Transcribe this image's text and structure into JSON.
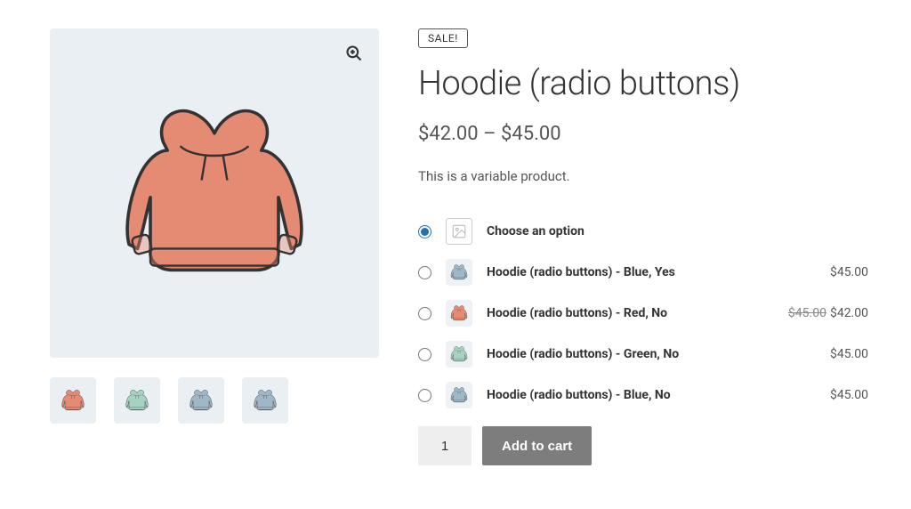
{
  "sale_badge": "SALE!",
  "title": "Hoodie (radio buttons)",
  "price_range": "$42.00 – $45.00",
  "short_description": "This is a variable product.",
  "variations": {
    "default_option_label": "Choose an option",
    "options": [
      {
        "label": "Hoodie (radio buttons) - Blue, Yes",
        "price": "$45.00",
        "color": "#9fb8c7"
      },
      {
        "label": "Hoodie (radio buttons) - Red, No",
        "old_price": "$45.00",
        "price": "$42.00",
        "color": "#e58a73"
      },
      {
        "label": "Hoodie (radio buttons) - Green, No",
        "price": "$45.00",
        "color": "#a6d2c2"
      },
      {
        "label": "Hoodie (radio buttons) - Blue, No",
        "price": "$45.00",
        "color": "#9fb8c7"
      }
    ]
  },
  "quantity": "1",
  "add_to_cart_label": "Add to cart",
  "gallery": {
    "main_color": "#e58a73",
    "thumbs": [
      {
        "color": "#e58a73"
      },
      {
        "color": "#a6d2c2"
      },
      {
        "color": "#9fb8c7"
      },
      {
        "color": "#9fb8c7"
      }
    ]
  }
}
